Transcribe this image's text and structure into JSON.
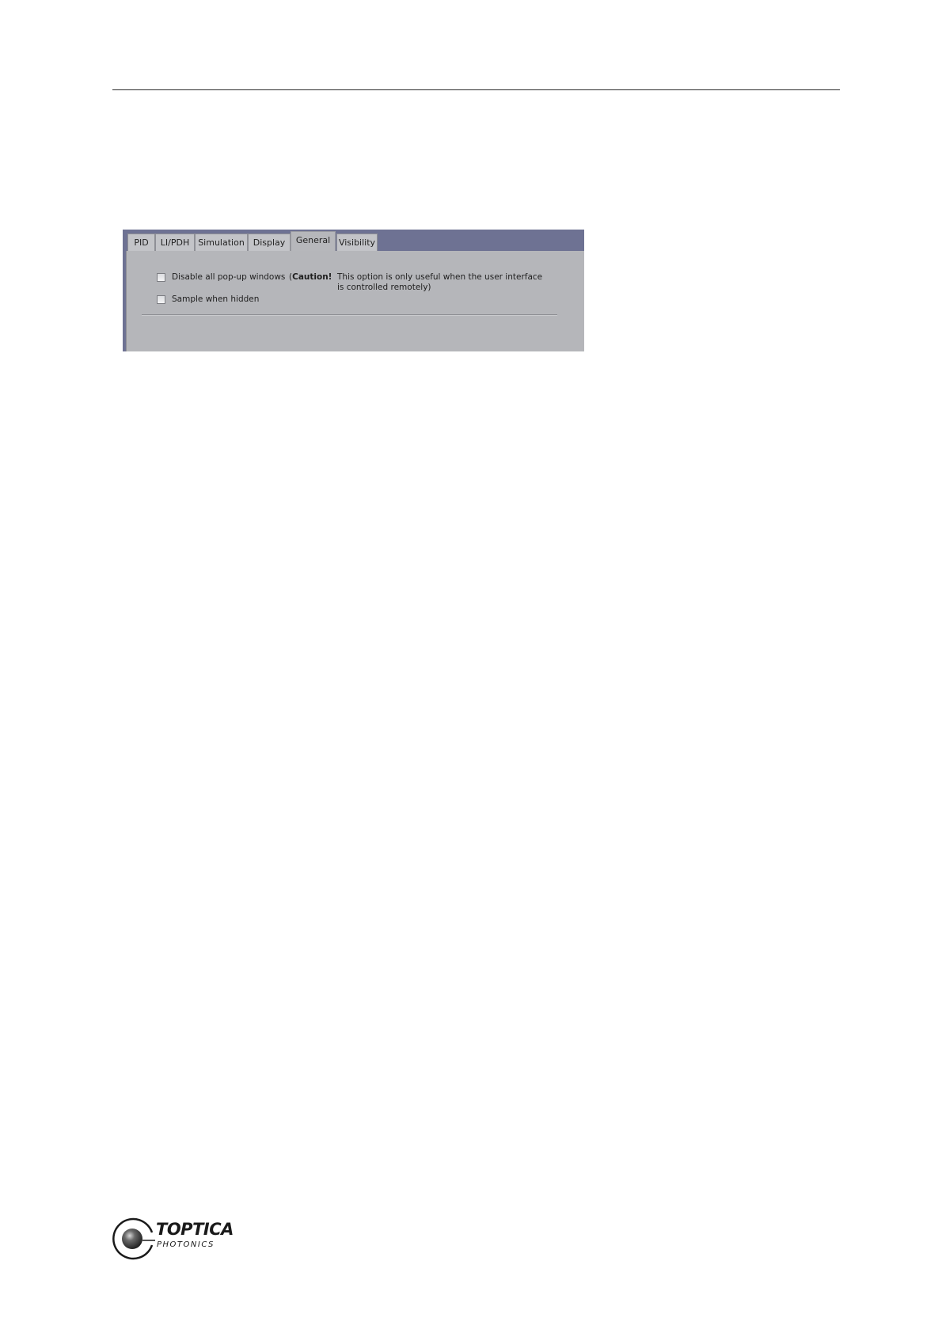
{
  "tabs": [
    {
      "label": "PID",
      "active": false
    },
    {
      "label": "LI/PDH",
      "active": false
    },
    {
      "label": "Simulation",
      "active": false
    },
    {
      "label": "Display",
      "active": false
    },
    {
      "label": "General",
      "active": true
    },
    {
      "label": "Visibility",
      "active": false
    }
  ],
  "general": {
    "options": [
      {
        "label": "Disable all pop-up windows",
        "checked": false
      },
      {
        "label": "Sample when hidden",
        "checked": false
      }
    ],
    "caution_open": "(",
    "caution_label": "Caution!",
    "caution_line1": "This option is only useful when the user interface",
    "caution_line2": "is controlled remotely)"
  },
  "logo": {
    "brand": "TOPTICA",
    "sub": "PHOTONICS"
  },
  "colors": {
    "tab_strip_bg": "#6e7293",
    "panel_bg": "#b5b6ba",
    "tab_bg": "#c3c4c8"
  }
}
